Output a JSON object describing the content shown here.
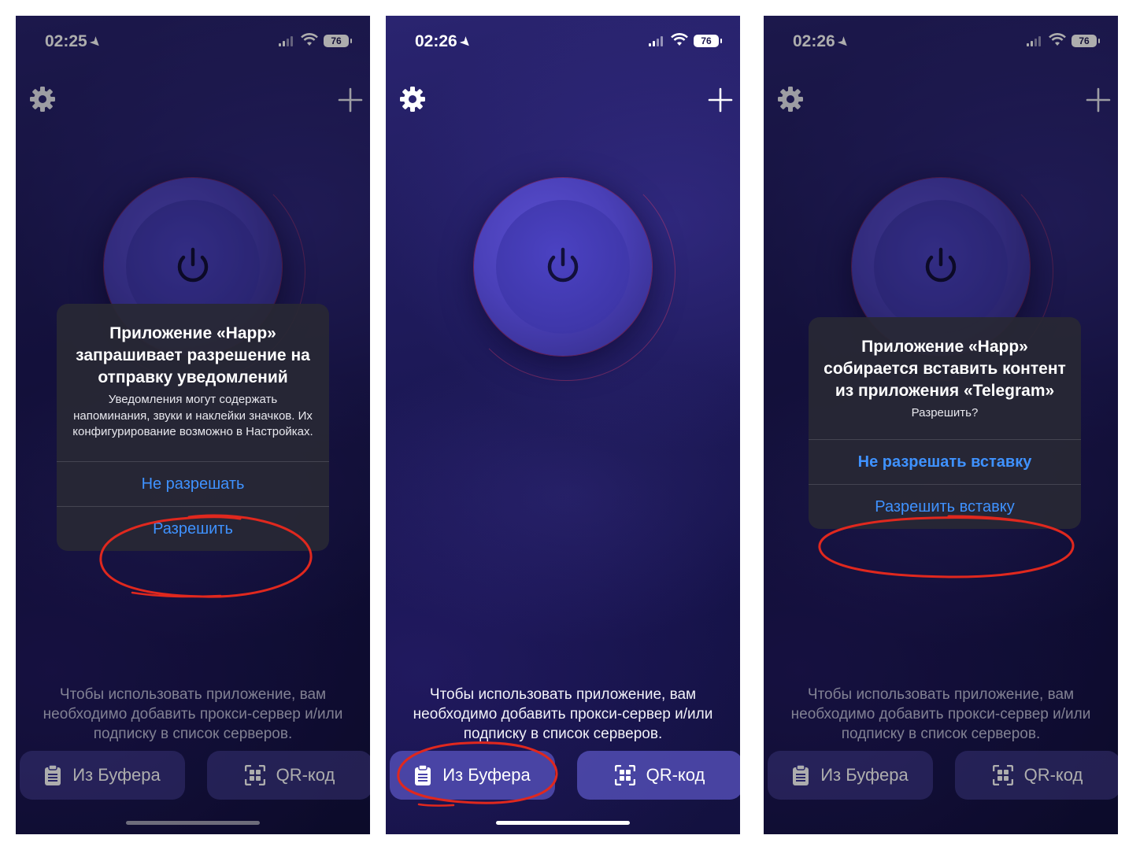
{
  "status": {
    "screen1_time": "02:25",
    "screen2_time": "02:26",
    "screen3_time": "02:26",
    "battery": "76"
  },
  "main": {
    "info_text": "Чтобы использовать приложение, вам необходимо добавить прокси-сервер и/или подписку в список серверов.",
    "clipboard_button": "Из Буфера",
    "qr_button": "QR-код"
  },
  "notification_alert": {
    "title": "Приложение «Happ» запрашивает разрешение на отправку уведомлений",
    "message": "Уведомления могут содержать напоминания, звуки и наклейки значков. Их конфигурирование возможно в Настройках.",
    "deny": "Не разрешать",
    "allow": "Разрешить"
  },
  "paste_alert": {
    "title": "Приложение «Happ» собирается вставить контент из приложения «Telegram»",
    "message": "Разрешить?",
    "deny": "Не разрешать вставку",
    "allow": "Разрешить вставку"
  },
  "colors": {
    "accent_link": "#3f92ff",
    "annotation_red": "#e0281e",
    "background": "#1e1a5a"
  },
  "icons": [
    "gear-icon",
    "plus-icon",
    "power-icon",
    "clipboard-icon",
    "qr-code-icon",
    "location-arrow-icon",
    "signal-icon",
    "wifi-icon",
    "battery-icon"
  ]
}
